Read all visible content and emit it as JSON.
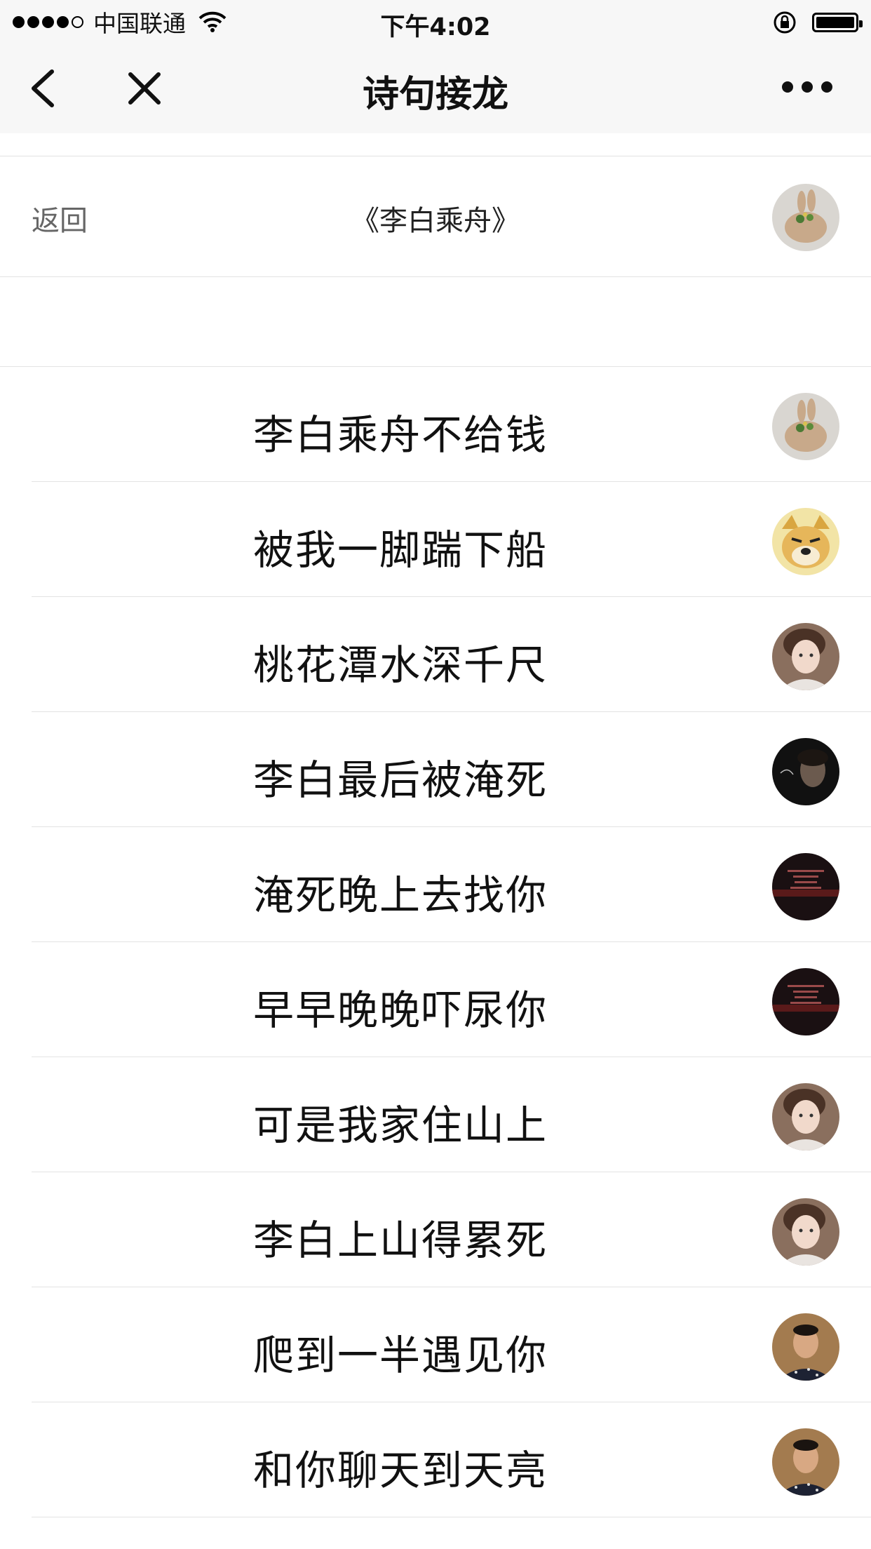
{
  "status_bar": {
    "carrier": "中国联通",
    "time": "下午4:02",
    "signal_dots_filled": 4,
    "signal_dots_total": 5
  },
  "nav": {
    "title": "诗句接龙"
  },
  "header": {
    "back_label": "返回",
    "poem_title": "《李白乘舟》",
    "avatar_icon": "rabbit-avatar"
  },
  "lines": [
    {
      "text": "李白乘舟不给钱",
      "avatar": "rabbit-avatar"
    },
    {
      "text": "被我一脚踹下船",
      "avatar": "doge-avatar"
    },
    {
      "text": "桃花潭水深千尺",
      "avatar": "girl-avatar"
    },
    {
      "text": "李白最后被淹死",
      "avatar": "dark-portrait-avatar"
    },
    {
      "text": "淹死晚上去找你",
      "avatar": "night-text-avatar"
    },
    {
      "text": "早早晚晚吓尿你",
      "avatar": "night-text-avatar"
    },
    {
      "text": "可是我家住山上",
      "avatar": "girl-avatar"
    },
    {
      "text": "李白上山得累死",
      "avatar": "girl-avatar"
    },
    {
      "text": "爬到一半遇见你",
      "avatar": "man-avatar"
    },
    {
      "text": "和你聊天到天亮",
      "avatar": "man-avatar"
    }
  ],
  "colors": {
    "nav_bg": "#f7f7f7",
    "divider": "#e3e3e3",
    "muted_text": "#666666"
  }
}
